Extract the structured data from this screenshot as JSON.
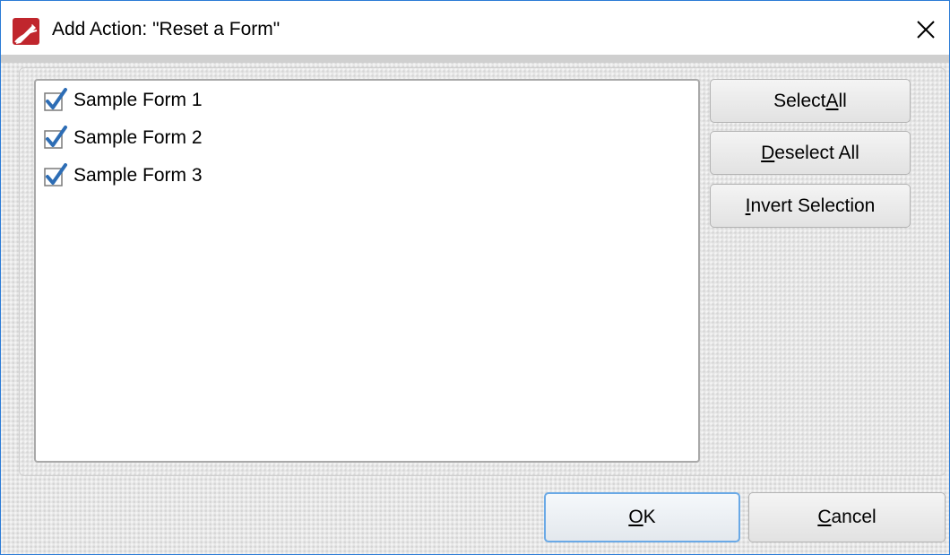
{
  "window": {
    "title": "Add Action: \"Reset a Form\"",
    "close_glyph": "✕",
    "border_color": "#2b7bd6",
    "app_icon": "pdf-editor-icon"
  },
  "forms_list": {
    "items": [
      {
        "label": "Sample Form 1",
        "checked": true
      },
      {
        "label": "Sample Form 2",
        "checked": true
      },
      {
        "label": "Sample Form 3",
        "checked": true
      }
    ]
  },
  "side_buttons": {
    "select_all": {
      "before": "Select ",
      "mnemonic": "A",
      "after": "ll"
    },
    "deselect_all": {
      "before": "",
      "mnemonic": "D",
      "after": "eselect All"
    },
    "invert_selection": {
      "before": "",
      "mnemonic": "I",
      "after": "nvert Selection"
    }
  },
  "dialog_buttons": {
    "ok": {
      "before": "",
      "mnemonic": "O",
      "after": "K"
    },
    "cancel": {
      "before": "",
      "mnemonic": "C",
      "after": "ancel"
    }
  },
  "colors": {
    "checkmark": "#2d6db5",
    "checkbox_border": "#7a7a7a",
    "default_button_border": "#6aa9e6"
  }
}
